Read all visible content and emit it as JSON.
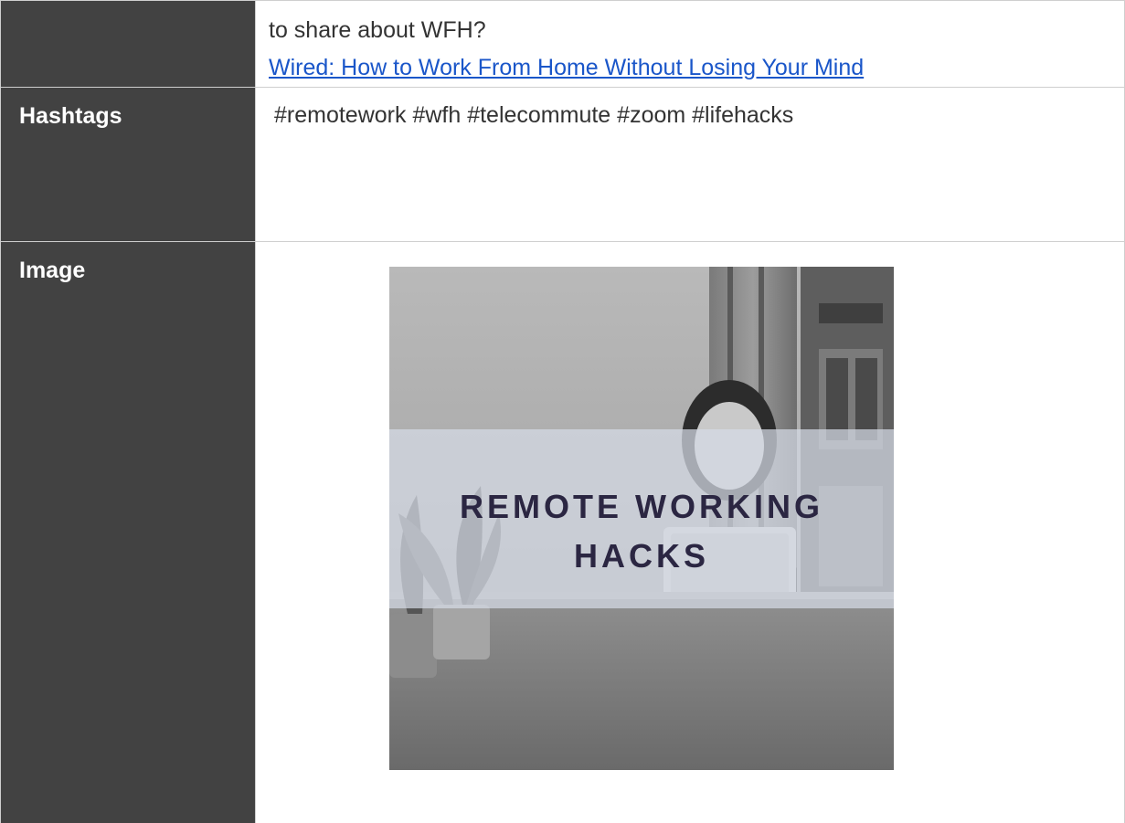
{
  "rows": {
    "intro": {
      "text": "to share about WFH?",
      "link_text": "Wired: How to Work From Home Without Losing Your Mind"
    },
    "hashtags": {
      "label": "Hashtags",
      "value": "#remotework #wfh #telecommute #zoom #lifehacks"
    },
    "image": {
      "label": "Image",
      "overlay_line1": "REMOTE WORKING",
      "overlay_line2": "HACKS"
    }
  },
  "colors": {
    "label_background": "#424242",
    "link": "#1a56c9",
    "border": "#cfcfcf",
    "overlay_text": "#2b2642"
  }
}
